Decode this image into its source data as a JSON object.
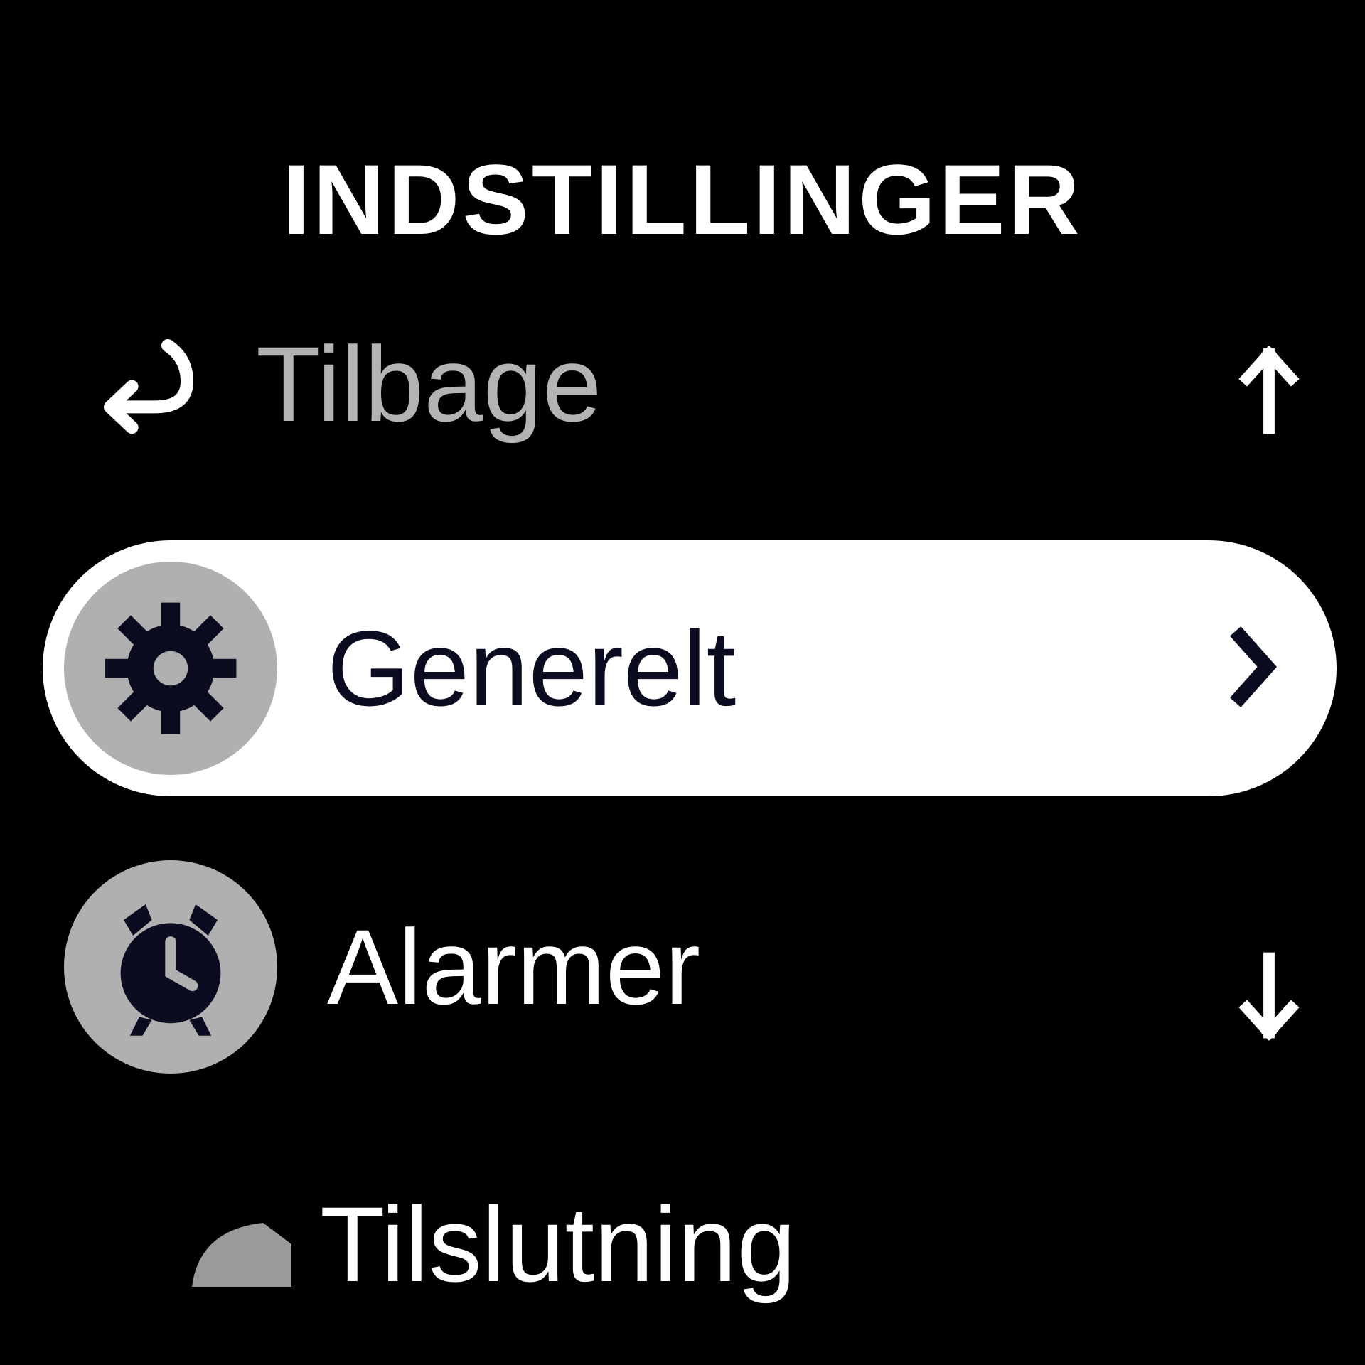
{
  "header": {
    "title": "INDSTILLINGER"
  },
  "menu": {
    "items": [
      {
        "label": "Tilbage",
        "icon": "back-arrow-icon"
      },
      {
        "label": "Generelt",
        "icon": "gear-icon",
        "selected": true
      },
      {
        "label": "Alarmer",
        "icon": "alarm-clock-icon"
      },
      {
        "label": "Tilslutning",
        "icon": "connection-icon"
      }
    ]
  },
  "nav": {
    "up": "arrow-up",
    "down": "arrow-down"
  }
}
